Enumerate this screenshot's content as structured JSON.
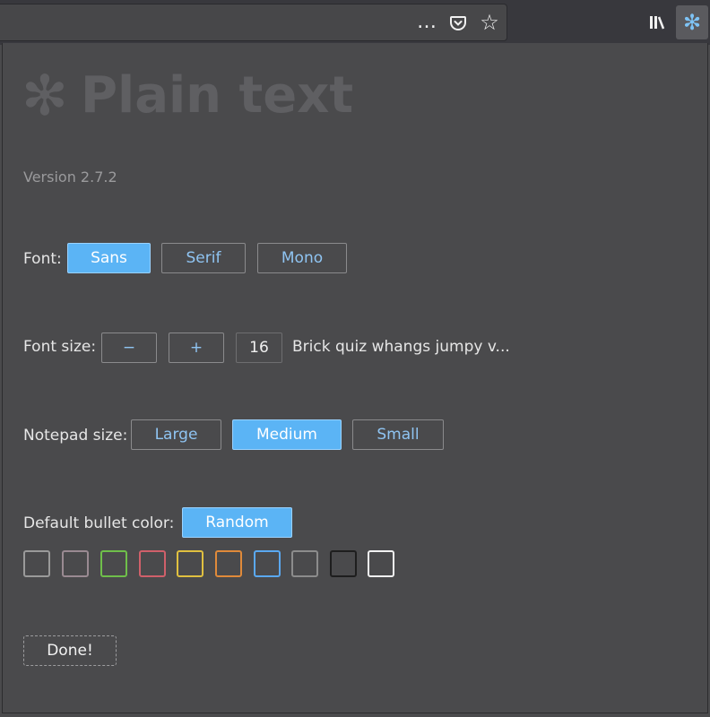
{
  "toolbar": {
    "more_icon": "…",
    "pocket_icon": "pocket-icon",
    "star_icon": "☆",
    "library_icon": "library-icon",
    "extension_icon": "✻"
  },
  "header": {
    "logo": "✻",
    "title": "Plain text",
    "version": "Version 2.7.2"
  },
  "font": {
    "label": "Font:",
    "options": [
      "Sans",
      "Serif",
      "Mono"
    ],
    "selected": "Sans"
  },
  "font_size": {
    "label": "Font size:",
    "decrease_label": "−",
    "increase_label": "+",
    "value": "16",
    "sample": "Brick quiz whangs jumpy v..."
  },
  "notepad_size": {
    "label": "Notepad size:",
    "options": [
      "Large",
      "Medium",
      "Small"
    ],
    "selected": "Medium"
  },
  "bullet_color": {
    "label": "Default bullet color:",
    "random_label": "Random",
    "swatches": [
      "#9a9a9a",
      "#9a8a92",
      "#6fbf4a",
      "#d0606a",
      "#e0c040",
      "#e08a3a",
      "#5aa8f0",
      "#8c8c8c",
      "#1e1e1e",
      "#f2f2f2"
    ]
  },
  "done_label": "Done!"
}
